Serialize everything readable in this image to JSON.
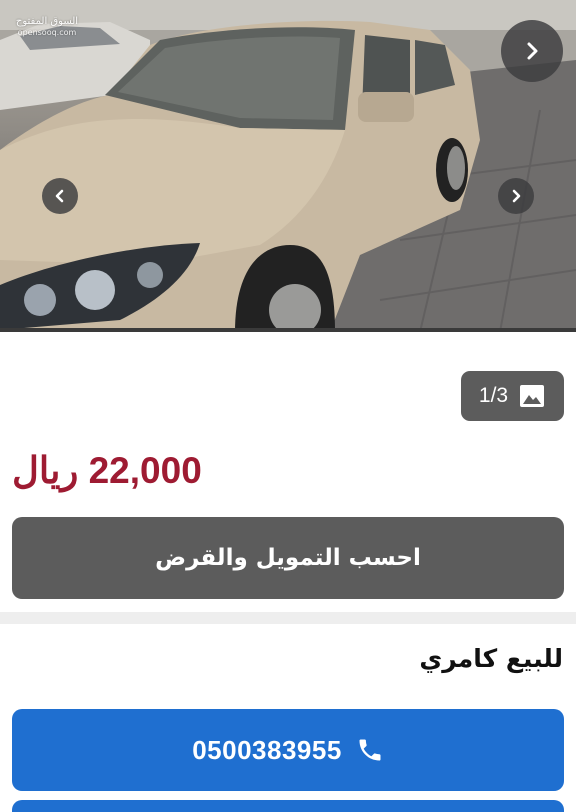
{
  "carousel": {
    "watermark_line1": "السوق المفتوح",
    "watermark_line2": "opensooq.com",
    "next_big_icon": "chevron-right-icon",
    "prev_icon": "chevron-left-icon",
    "next_icon": "chevron-right-icon"
  },
  "gallery": {
    "counter": "1/3",
    "icon": "image-icon"
  },
  "listing": {
    "price": "22,000 ريال",
    "finance_label": "احسب التمويل والقرض",
    "title": "للبيع كامري",
    "phone": "0500383955",
    "phone_icon": "phone-icon"
  },
  "colors": {
    "price": "#9e1b32",
    "finance_button": "#5c5c5c",
    "call_button": "#1f6fd0",
    "divider": "#eeeeee"
  }
}
